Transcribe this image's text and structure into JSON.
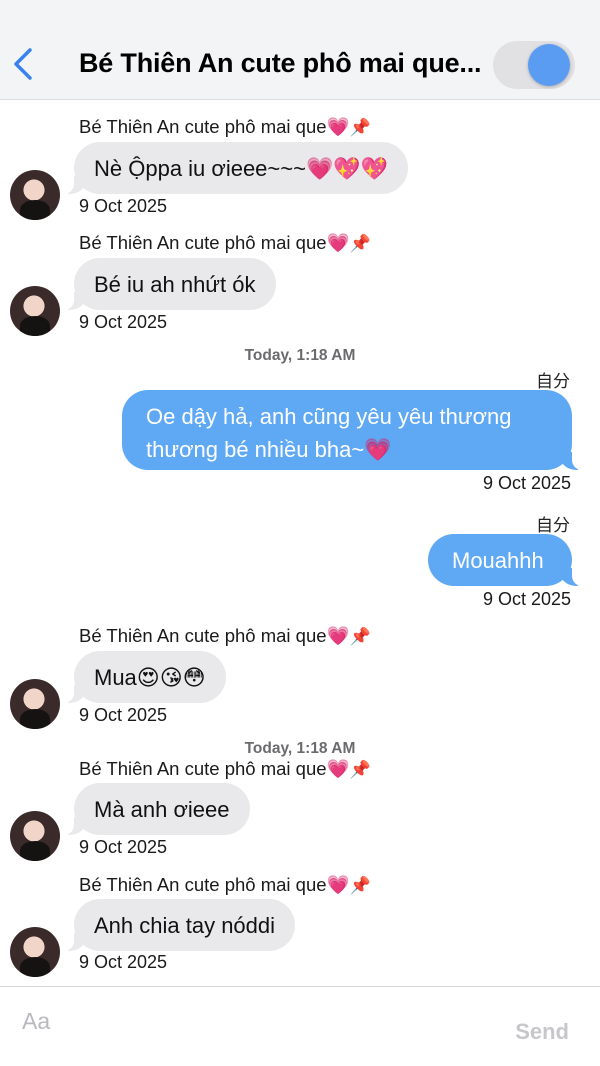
{
  "header": {
    "title": "Bé Thiên An cute phô mai que..."
  },
  "messages": [
    {
      "sender": "Bé Thiên An cute phô mai que💗",
      "text": "Nè Ộppa iu ơieee~~~💗💖💖",
      "date": "9 Oct 2025"
    },
    {
      "sender": "Bé Thiên An cute phô mai que💗",
      "text": "Bé iu ah nhứt ók",
      "date": "9 Oct 2025"
    },
    {
      "timestamp": "Today, 1:18 AM",
      "me_label": "自分",
      "text": "Oe dậy hả, anh cũng yêu yêu thương thương bé nhiều bha~💗",
      "date": "9 Oct 2025"
    },
    {
      "me_label": "自分",
      "text": "Mouahhh",
      "date": "9 Oct 2025"
    },
    {
      "sender": "Bé Thiên An cute phô mai que💗",
      "text": "Mua😍😘😳",
      "date": "9 Oct 2025"
    },
    {
      "timestamp": "Today, 1:18 AM",
      "sender": "Bé Thiên An cute phô mai que💗",
      "text": "Mà anh ơieee",
      "date": "9 Oct 2025"
    },
    {
      "sender": "Bé Thiên An cute phô mai que💗",
      "text": "Anh chia tay nóddi",
      "date": "9 Oct 2025"
    }
  ],
  "composer": {
    "placeholder": "Aa",
    "send_label": "Send"
  },
  "colors": {
    "outgoing_bubble": "#5fa8f3",
    "incoming_bubble": "#e9e9eb",
    "toggle_knob": "#5b9cf3"
  },
  "icons": {
    "back": "chevron-left-icon",
    "pin": "pushpin-icon"
  }
}
